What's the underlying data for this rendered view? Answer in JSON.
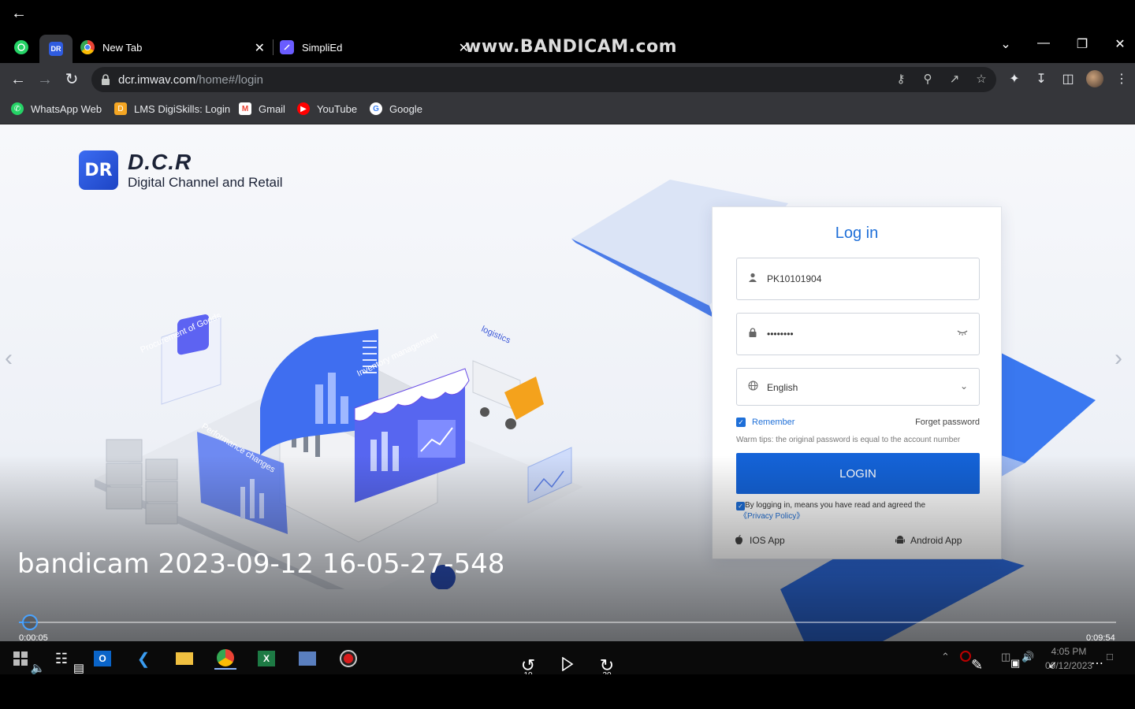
{
  "browser": {
    "tabs": [
      {
        "label": "",
        "icon": "whatsapp-icon"
      },
      {
        "label": "",
        "icon": "dcr-icon",
        "active": true
      },
      {
        "label": "New Tab",
        "icon": "chrome-icon"
      },
      {
        "label": "SimpliEd",
        "icon": "simplied-icon"
      }
    ],
    "watermark": "www.BANDICAM.com",
    "url_host": "dcr.imwav.com",
    "url_path": "/home#/login"
  },
  "bookmarks": [
    {
      "label": "WhatsApp Web",
      "icon": "whatsapp-icon",
      "color": "#25d366"
    },
    {
      "label": "LMS DigiSkills: Login",
      "icon": "digiskills-icon",
      "color": "#f5a623"
    },
    {
      "label": "Gmail",
      "icon": "gmail-icon",
      "color": "#ea4335"
    },
    {
      "label": "YouTube",
      "icon": "youtube-icon",
      "color": "#ff0000"
    },
    {
      "label": "Google",
      "icon": "google-icon",
      "color": "#4285f4"
    }
  ],
  "brand": {
    "mark": "DR",
    "title": "D.C.R",
    "subtitle": "Digital Channel and Retail"
  },
  "illustration": {
    "labels": [
      "Procurement of Goods",
      "Inventory management",
      "logistics",
      "Performance changes"
    ]
  },
  "login": {
    "title": "Log in",
    "account_value": "PK10101904",
    "password_value": "••••••••",
    "language_value": "English",
    "remember_label": "Remember",
    "remember_checked": true,
    "forget_label": "Forget password",
    "tips": "Warm tips: the original password is equal to the account number",
    "button_label": "LOGIN",
    "agree_text": "By logging in, means you have read and agreed the",
    "privacy_label": "《Privacy Policy》",
    "ios_label": "IOS App",
    "android_label": "Android App",
    "accent": "#1463d8"
  },
  "video": {
    "title": "bandicam 2023-09-12 16-05-27-548",
    "current_time": "0:00:05",
    "total_time": "0:09:54",
    "progress": 0.0084,
    "rewind_label": "10",
    "forward_label": "30"
  },
  "taskbar": {
    "time": "4:05 PM",
    "date": "09/12/2023"
  }
}
